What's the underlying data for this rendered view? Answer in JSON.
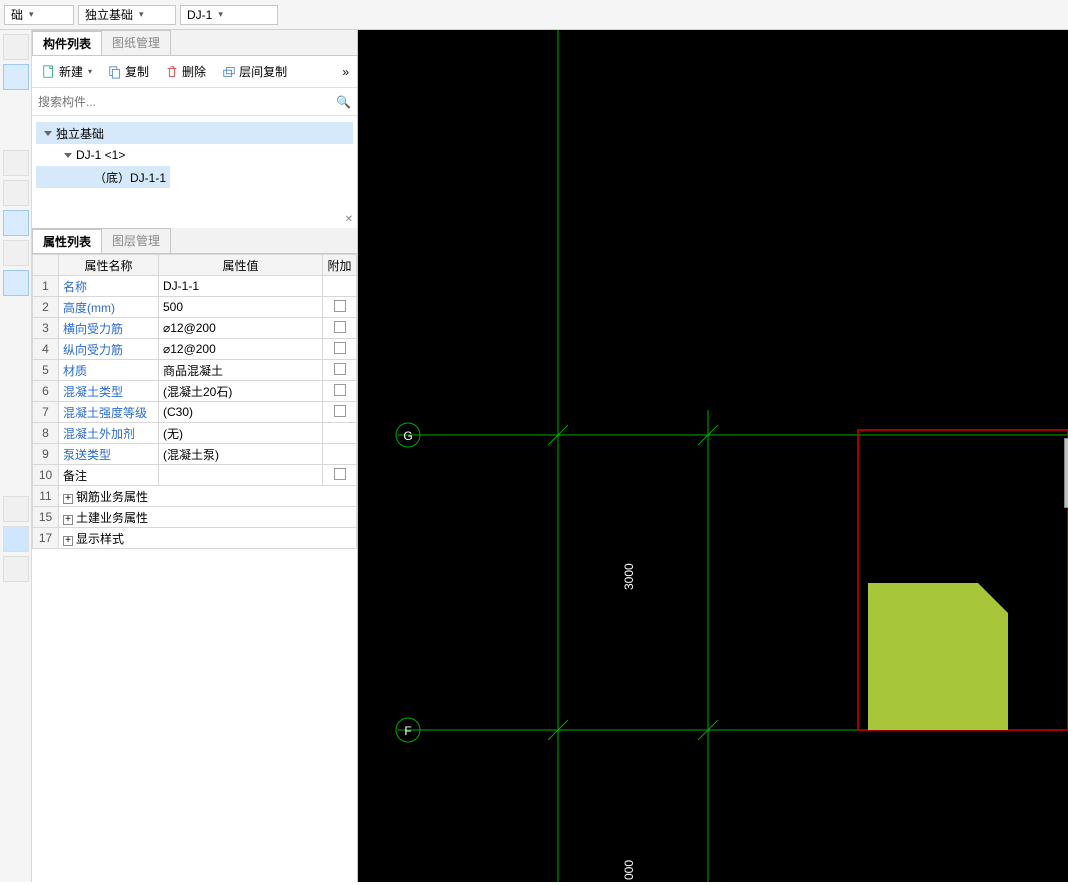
{
  "top_dropdowns": {
    "d1": "础",
    "d2": "独立基础",
    "d3": "DJ-1"
  },
  "component_panel": {
    "tabs": {
      "list": "构件列表",
      "drawing": "图纸管理"
    },
    "toolbar": {
      "new": "新建",
      "copy": "复制",
      "delete": "删除",
      "layer_copy": "层间复制",
      "more": "»"
    },
    "search_placeholder": "搜索构件...",
    "tree": {
      "root": "独立基础",
      "node1": "DJ-1  <1>",
      "node2": "（底）DJ-1-1"
    }
  },
  "property_panel": {
    "tabs": {
      "props": "属性列表",
      "layers": "图层管理"
    },
    "headers": {
      "name": "属性名称",
      "value": "属性值",
      "add": "附加"
    },
    "rows": [
      {
        "n": "1",
        "name": "名称",
        "value": "DJ-1-1",
        "link": true,
        "chk": false
      },
      {
        "n": "2",
        "name": "高度(mm)",
        "value": "500",
        "link": true,
        "chk": true
      },
      {
        "n": "3",
        "name": "横向受力筋",
        "value": "⌀12@200",
        "link": true,
        "chk": true
      },
      {
        "n": "4",
        "name": "纵向受力筋",
        "value": "⌀12@200",
        "link": true,
        "chk": true
      },
      {
        "n": "5",
        "name": "材质",
        "value": "商品混凝土",
        "link": true,
        "chk": true
      },
      {
        "n": "6",
        "name": "混凝土类型",
        "value": "(混凝土20石)",
        "link": true,
        "chk": true
      },
      {
        "n": "7",
        "name": "混凝土强度等级",
        "value": "(C30)",
        "link": true,
        "chk": true
      },
      {
        "n": "8",
        "name": "混凝土外加剂",
        "value": "(无)",
        "link": true,
        "chk": false
      },
      {
        "n": "9",
        "name": "泵送类型",
        "value": "(混凝土泵)",
        "link": true,
        "chk": false
      },
      {
        "n": "10",
        "name": "备注",
        "value": "",
        "link": false,
        "chk": true
      }
    ],
    "groups": [
      {
        "n": "11",
        "label": "钢筋业务属性"
      },
      {
        "n": "15",
        "label": "土建业务属性"
      },
      {
        "n": "17",
        "label": "显示样式"
      }
    ]
  },
  "canvas": {
    "axis_labels": {
      "g": "G",
      "f": "F"
    },
    "dim1": "3000",
    "dim2": "000"
  }
}
